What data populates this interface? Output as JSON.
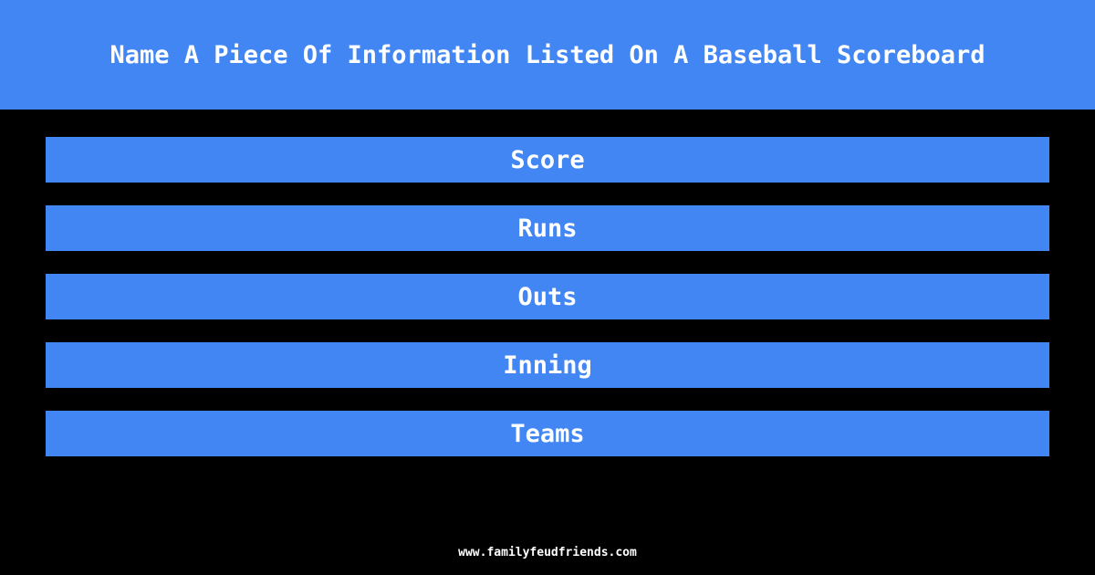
{
  "question": "Name A Piece Of Information Listed On A Baseball Scoreboard",
  "answers": [
    "Score",
    "Runs",
    "Outs",
    "Inning",
    "Teams"
  ],
  "footer": "www.familyfeudfriends.com",
  "colors": {
    "accent": "#4286f4",
    "background": "#000000",
    "text": "#ffffff"
  }
}
